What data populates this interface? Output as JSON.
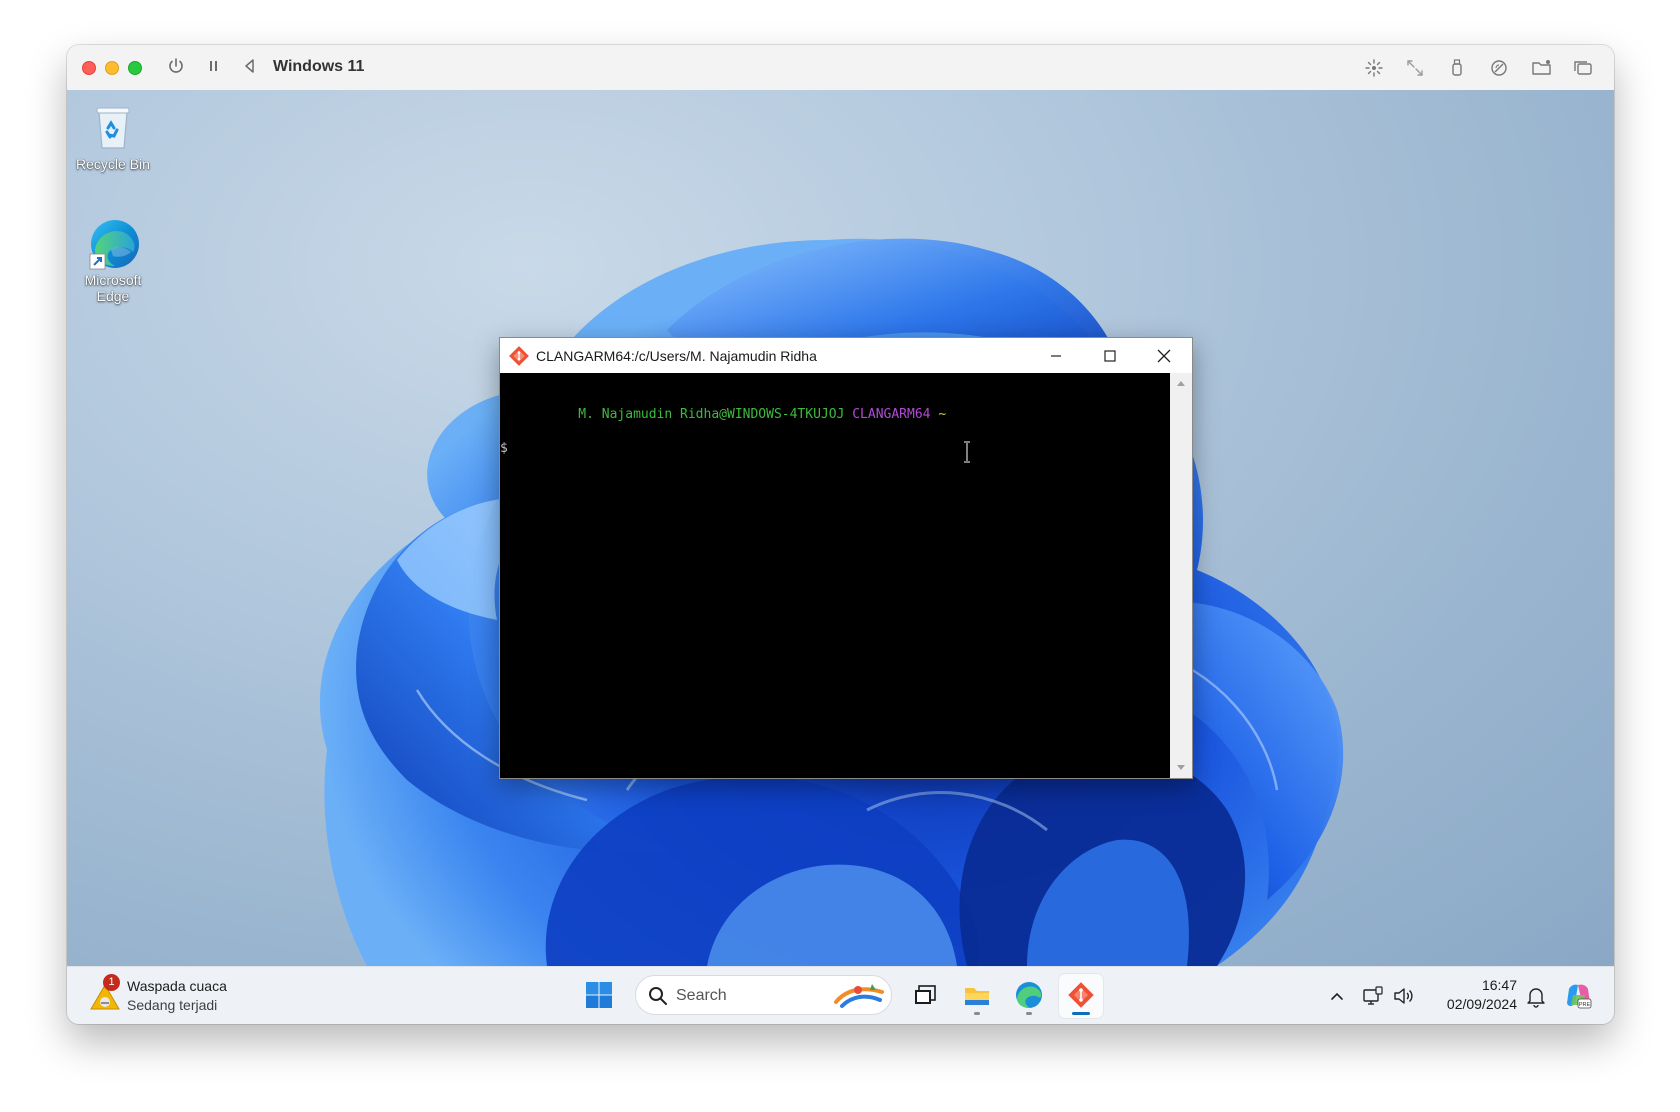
{
  "vm_window": {
    "title": "Windows 11",
    "controls": [
      "power-icon",
      "pause-icon",
      "back-icon"
    ],
    "right_icons": [
      "brightness-icon",
      "resize-icon",
      "usb-icon",
      "network-icon",
      "shared-folder-icon",
      "window-icon"
    ]
  },
  "desktop": {
    "icons": [
      {
        "label": "Recycle Bin",
        "icon": "recycle-bin-icon"
      },
      {
        "label": "Microsoft Edge",
        "icon": "edge-icon"
      }
    ]
  },
  "terminal": {
    "title": "CLANGARM64:/c/Users/M. Najamudin Ridha",
    "prompt_user": "M. Najamudin Ridha@WINDOWS-4TKUJOJ",
    "prompt_env": "CLANGARM64",
    "prompt_path": "~",
    "prompt_symbol": "$",
    "colors": {
      "user": "#3dbb3d",
      "env": "#b04bd6",
      "path": "#d8c64a",
      "text": "#c0c0c0"
    }
  },
  "taskbar": {
    "weather": {
      "title": "Waspada cuaca",
      "subtitle": "Sedang terjadi",
      "badge": "1"
    },
    "search_placeholder": "Search",
    "apps": [
      "task-view-icon",
      "file-explorer-icon",
      "edge-icon",
      "git-bash-icon"
    ],
    "tray": {
      "time": "16:47",
      "date": "02/09/2024"
    }
  }
}
